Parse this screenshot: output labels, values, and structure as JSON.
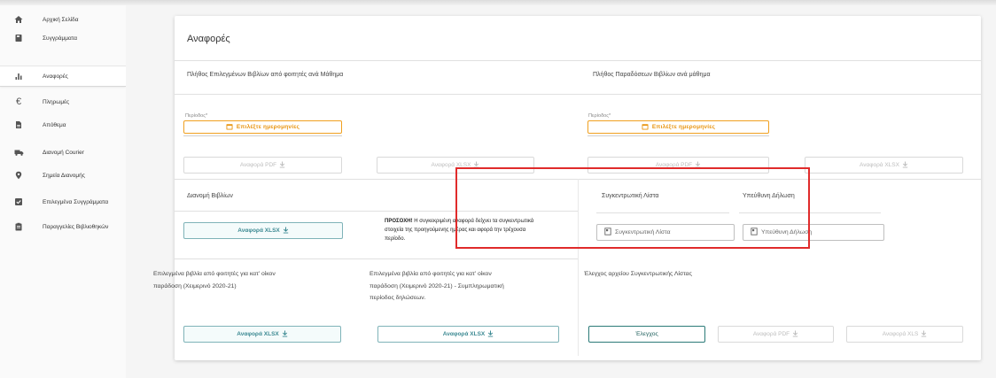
{
  "sidebar": {
    "items": [
      {
        "label": "Αρχική Σελίδα",
        "icon": "home-icon"
      },
      {
        "label": "Συγγράμματα",
        "icon": "book-icon"
      },
      {
        "label": "Αναφορές",
        "icon": "bar-chart-icon",
        "active": true
      },
      {
        "label": "Πληρωμές",
        "icon": "euro-icon"
      },
      {
        "label": "Απόθεμα",
        "icon": "document-icon"
      },
      {
        "label": "Διανομή Courier",
        "icon": "truck-icon"
      },
      {
        "label": "Σημεία Διανομής",
        "icon": "location-pin-icon"
      },
      {
        "label": "Επιλεγμένα Συγγράμματα",
        "icon": "checkbox-icon"
      },
      {
        "label": "Παραγγελίες Βιβλιοθηκών",
        "icon": "clipboard-icon"
      }
    ]
  },
  "page": {
    "title": "Αναφορές"
  },
  "sections": {
    "selected_books": {
      "title": "Πλήθος Επιλεγμένων Βιβλίων από φοιτητές ανά Μάθημα",
      "period_label": "Περίοδος*",
      "date_button": "Επιλέξτε ημερομηνίες",
      "pdf_button": "Αναφορά PDF",
      "xlsx_button": "Αναφορά XLSX"
    },
    "deliveries": {
      "title": "Πλήθος Παραδόσεων Βιβλίων ανά μάθημα",
      "period_label": "Περίοδος*",
      "date_button": "Επιλέξτε ημερομηνίες",
      "pdf_button": "Αναφορά PDF",
      "xlsx_button": "Αναφορά XLSX"
    },
    "distribution": {
      "title": "Διανομή Βιβλίων",
      "xlsx_button": "Αναφορά XLSX",
      "notice_bold": "ΠΡΟΣΟΧΗ!",
      "notice_text_1": "Η συγκεκριμένη αναφορά δείχνει τα συγκεντρωτικά",
      "notice_text_2": "στοιχεία της προηγούμενης ημέρας και αφορά την τρέχουσα",
      "notice_text_3": "περίοδο."
    },
    "summary_list": {
      "title": "Συγκεντρωτική Λίστα",
      "file_button": "Συγκεντρωτική Λίστα"
    },
    "declaration": {
      "title": "Υπεύθυνη Δήλωση",
      "file_button": "Υπεύθυνη Δήλωση"
    },
    "home_delivery": {
      "line1": "Επιλεγμένα βιβλία από φοιτητές για κατ' οίκον",
      "line2": "παράδοση (Χειμερινό 2020-21)",
      "xlsx_button": "Αναφορά XLSX"
    },
    "home_delivery_supplementary": {
      "line1": "Επιλεγμένα βιβλία από φοιτητές για κατ' οίκον",
      "line2": "παράδοση (Χειμερινό 2020-21) - Συμπληρωματική",
      "line3": "περίοδος δηλώσεων.",
      "xlsx_button": "Αναφορά XLSX"
    },
    "file_check": {
      "title": "Έλεγχος αρχείου Συγκεντρωτικής Λίστας",
      "check_button": "Έλεγχος",
      "pdf_button": "Αναφορά PDF",
      "xls_button": "Αναφορά XLS"
    }
  },
  "colors": {
    "accent_orange": "#e8940f",
    "accent_teal": "#3d8a93",
    "highlight_red": "#e02b2b"
  }
}
